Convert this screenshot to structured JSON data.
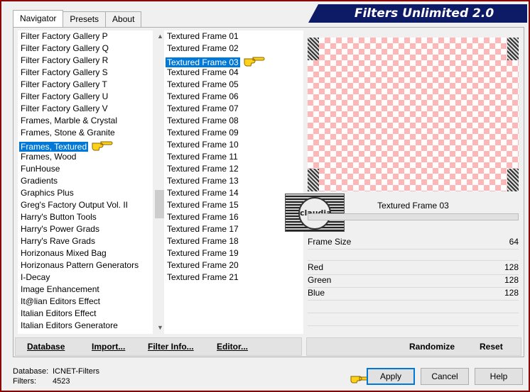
{
  "app": {
    "title": "Filters Unlimited 2.0"
  },
  "tabs": [
    {
      "label": "Navigator",
      "active": true
    },
    {
      "label": "Presets",
      "active": false
    },
    {
      "label": "About",
      "active": false
    }
  ],
  "categories": [
    "Filter Factory Gallery P",
    "Filter Factory Gallery Q",
    "Filter Factory Gallery R",
    "Filter Factory Gallery S",
    "Filter Factory Gallery T",
    "Filter Factory Gallery U",
    "Filter Factory Gallery V",
    "Frames, Marble & Crystal",
    "Frames, Stone & Granite",
    "Frames, Textured",
    "Frames, Wood",
    "FunHouse",
    "Gradients",
    "Graphics Plus",
    "Greg's Factory Output Vol. II",
    "Harry's Button Tools",
    "Harry's Power Grads",
    "Harry's Rave Grads",
    "Horizonaus Mixed Bag",
    "Horizonaus Pattern Generators",
    "I-Decay",
    "Image Enhancement",
    "It@lian Editors Effect",
    "Italian Editors Effect",
    "Italian Editors Generatore"
  ],
  "selected_category_index": 9,
  "filters": [
    "Textured Frame 01",
    "Textured Frame 02",
    "Textured Frame 03",
    "Textured Frame 04",
    "Textured Frame 05",
    "Textured Frame 06",
    "Textured Frame 07",
    "Textured Frame 08",
    "Textured Frame 09",
    "Textured Frame 10",
    "Textured Frame 11",
    "Textured Frame 12",
    "Textured Frame 13",
    "Textured Frame 14",
    "Textured Frame 15",
    "Textured Frame 16",
    "Textured Frame 17",
    "Textured Frame 18",
    "Textured Frame 19",
    "Textured Frame 20",
    "Textured Frame 21"
  ],
  "selected_filter_index": 2,
  "preview": {
    "filter_name": "Textured Frame 03",
    "watermark": "claudia"
  },
  "params": {
    "frame_size": {
      "label": "Frame Size",
      "value": "64"
    },
    "red": {
      "label": "Red",
      "value": "128"
    },
    "green": {
      "label": "Green",
      "value": "128"
    },
    "blue": {
      "label": "Blue",
      "value": "128"
    }
  },
  "left_buttons": {
    "database": "Database",
    "import": "Import...",
    "filter_info": "Filter Info...",
    "editor": "Editor..."
  },
  "right_buttons": {
    "randomize": "Randomize",
    "reset": "Reset"
  },
  "dialog_buttons": {
    "apply": "Apply",
    "cancel": "Cancel",
    "help": "Help"
  },
  "status": {
    "database_label": "Database:",
    "database_value": "ICNET-Filters",
    "filters_label": "Filters:",
    "filters_value": "4523"
  },
  "colors": {
    "title_bg": "#0d1a66",
    "checker_pink": "#ffb6b6",
    "selection": "#0078d7",
    "window_border": "#8b0000"
  }
}
